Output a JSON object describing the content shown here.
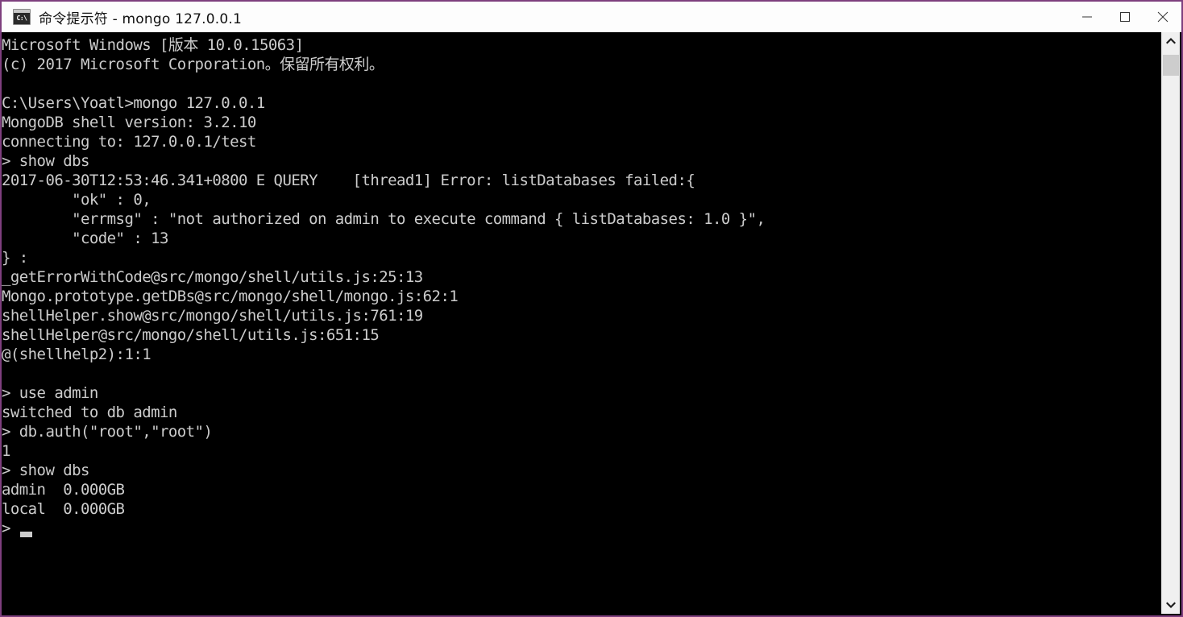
{
  "window": {
    "title": "命令提示符 - mongo  127.0.0.1",
    "icon_label": "C:\\",
    "icon_name": "command-prompt-icon",
    "border_color": "#7e3f7e",
    "titlebar_bg": "#fdfdfd",
    "console_bg": "#000000",
    "console_fg": "#cccccc",
    "buttons": {
      "minimize": "Minimize",
      "maximize": "Maximize",
      "close": "Close"
    }
  },
  "scrollbar": {
    "up_arrow": "Scroll up",
    "down_arrow": "Scroll down",
    "thumb": "Scroll thumb"
  },
  "console": {
    "lines": [
      "Microsoft Windows [版本 10.0.15063]",
      "(c) 2017 Microsoft Corporation。保留所有权利。",
      "",
      "C:\\Users\\Yoatl>mongo 127.0.0.1",
      "MongoDB shell version: 3.2.10",
      "connecting to: 127.0.0.1/test",
      "> show dbs",
      "2017-06-30T12:53:46.341+0800 E QUERY    [thread1] Error: listDatabases failed:{",
      "        \"ok\" : 0,",
      "        \"errmsg\" : \"not authorized on admin to execute command { listDatabases: 1.0 }\",",
      "        \"code\" : 13",
      "} :",
      "_getErrorWithCode@src/mongo/shell/utils.js:25:13",
      "Mongo.prototype.getDBs@src/mongo/shell/mongo.js:62:1",
      "shellHelper.show@src/mongo/shell/utils.js:761:19",
      "shellHelper@src/mongo/shell/utils.js:651:15",
      "@(shellhelp2):1:1",
      "",
      "> use admin",
      "switched to db admin",
      "> db.auth(\"root\",\"root\")",
      "1",
      "> show dbs",
      "admin  0.000GB",
      "local  0.000GB",
      ">"
    ],
    "cursor_line_index": 25
  }
}
